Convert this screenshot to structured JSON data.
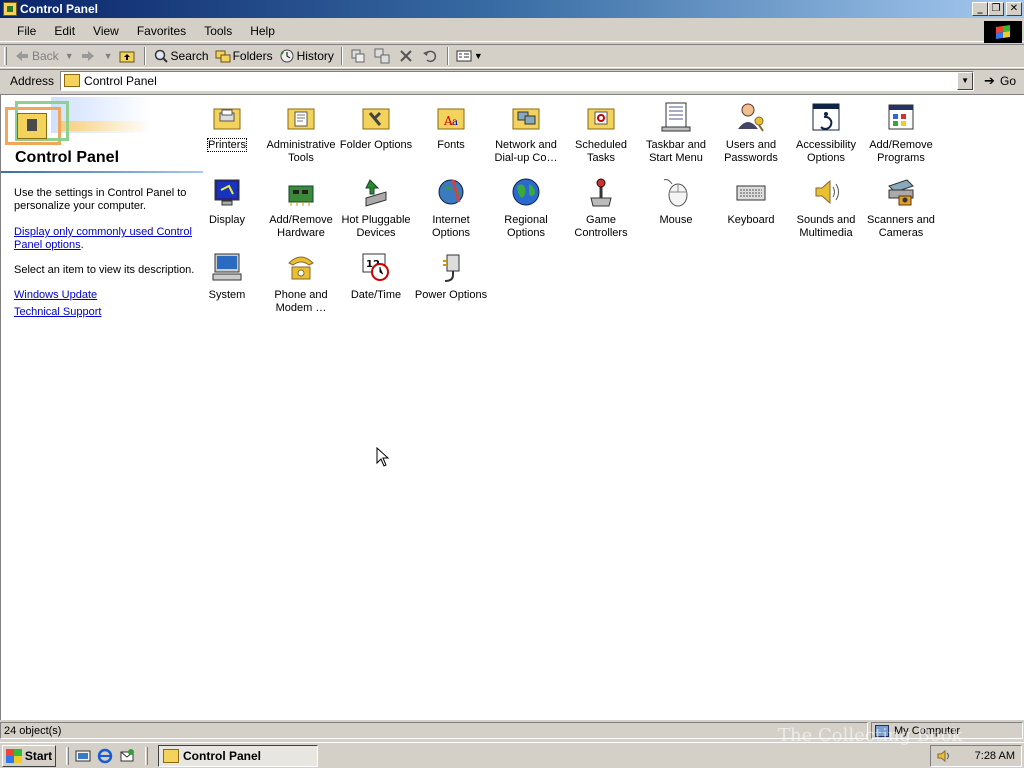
{
  "window": {
    "title": "Control Panel",
    "buttons": {
      "minimize": "_",
      "restore": "❐",
      "close": "✕"
    }
  },
  "menubar": {
    "items": [
      "File",
      "Edit",
      "View",
      "Favorites",
      "Tools",
      "Help"
    ]
  },
  "toolbar": {
    "back": "Back",
    "search": "Search",
    "folders": "Folders",
    "history": "History"
  },
  "addressbar": {
    "label": "Address",
    "value": "Control Panel",
    "go": "Go"
  },
  "left_pane": {
    "title": "Control Panel",
    "description": "Use the settings in Control Panel to personalize your computer.",
    "display_link": "Display only commonly used Control Panel options",
    "display_link_suffix": ".",
    "select_hint": "Select an item to view its description.",
    "windows_update": "Windows Update",
    "technical_support": "Technical Support"
  },
  "items": [
    {
      "label": "Printers",
      "icon": "printer-folder-icon",
      "selected": true
    },
    {
      "label": "Administrative Tools",
      "icon": "admin-tools-icon"
    },
    {
      "label": "Folder Options",
      "icon": "folder-options-icon"
    },
    {
      "label": "Fonts",
      "icon": "fonts-folder-icon"
    },
    {
      "label": "Network and Dial-up Co…",
      "icon": "network-folder-icon"
    },
    {
      "label": "Scheduled Tasks",
      "icon": "scheduled-tasks-icon"
    },
    {
      "label": "Taskbar and Start Menu",
      "icon": "taskbar-icon"
    },
    {
      "label": "Users and Passwords",
      "icon": "users-icon"
    },
    {
      "label": "Accessibility Options",
      "icon": "accessibility-icon"
    },
    {
      "label": "Add/Remove Programs",
      "icon": "add-remove-programs-icon"
    },
    {
      "label": "Display",
      "icon": "display-icon"
    },
    {
      "label": "Add/Remove Hardware",
      "icon": "add-remove-hardware-icon"
    },
    {
      "label": "Hot Pluggable Devices",
      "icon": "hot-plug-icon"
    },
    {
      "label": "Internet Options",
      "icon": "internet-options-icon"
    },
    {
      "label": "Regional Options",
      "icon": "globe-icon"
    },
    {
      "label": "Game Controllers",
      "icon": "joystick-icon"
    },
    {
      "label": "Mouse",
      "icon": "mouse-icon"
    },
    {
      "label": "Keyboard",
      "icon": "keyboard-icon"
    },
    {
      "label": "Sounds and Multimedia",
      "icon": "speaker-icon"
    },
    {
      "label": "Scanners and Cameras",
      "icon": "scanner-icon"
    },
    {
      "label": "System",
      "icon": "computer-icon"
    },
    {
      "label": "Phone and Modem …",
      "icon": "phone-icon"
    },
    {
      "label": "Date/Time",
      "icon": "calendar-clock-icon"
    },
    {
      "label": "Power Options",
      "icon": "power-plug-icon"
    }
  ],
  "statusbar": {
    "objects": "24 object(s)",
    "zone": "My Computer"
  },
  "taskbar": {
    "start": "Start",
    "task": "Control Panel",
    "clock": "7:28 AM"
  },
  "watermark": "The Collecting Book"
}
